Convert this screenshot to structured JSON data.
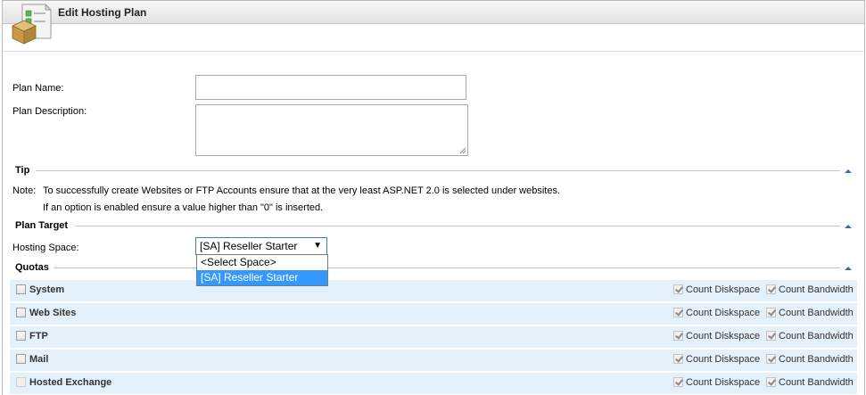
{
  "header": {
    "title": "Edit Hosting Plan",
    "icon": "hosting-plan-icon"
  },
  "form": {
    "plan_name_label": "Plan Name:",
    "plan_name_value": "",
    "plan_description_label": "Plan Description:",
    "plan_description_value": ""
  },
  "tip": {
    "title": "Tip",
    "note_label": "Note:",
    "line1": "To successfully create Websites or FTP Accounts ensure that at the very least ASP.NET 2.0 is selected under websites.",
    "line2": "If an option is enabled ensure a value higher than \"0\" is inserted."
  },
  "plan_target": {
    "title": "Plan Target",
    "hosting_space_label": "Hosting Space:",
    "selected": "[SA] Reseller Starter",
    "options": [
      "<Select Space>",
      "[SA] Reseller Starter"
    ]
  },
  "quotas": {
    "title": "Quotas",
    "count_diskspace_label": "Count Diskspace",
    "count_bandwidth_label": "Count Bandwidth",
    "rows": [
      {
        "name": "System"
      },
      {
        "name": "Web Sites"
      },
      {
        "name": "FTP"
      },
      {
        "name": "Mail"
      },
      {
        "name": "Hosted Exchange"
      }
    ]
  },
  "colors": {
    "section_line": "#b9c6dc",
    "row_bg": "#e4f1fb",
    "selection": "#3399ff"
  }
}
